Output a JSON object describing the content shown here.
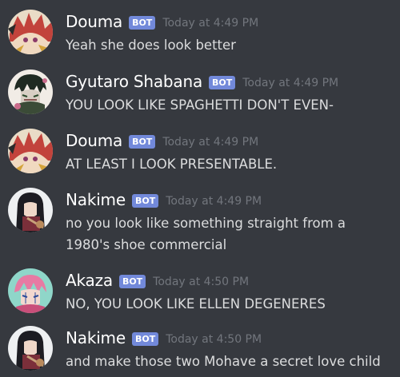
{
  "messages": [
    {
      "author": "Douma",
      "badge": "BOT",
      "time": "Today at 4:49 PM",
      "text": "Yeah she does look better",
      "avatar": "douma-avatar"
    },
    {
      "author": "Gyutaro Shabana",
      "badge": "BOT",
      "time": "Today at 4:49 PM",
      "text": "YOU LOOK LIKE SPAGHETTI DON'T EVEN-",
      "avatar": "gyutaro-avatar"
    },
    {
      "author": "Douma",
      "badge": "BOT",
      "time": "Today at 4:49 PM",
      "text": "AT LEAST I LOOK PRESENTABLE.",
      "avatar": "douma-avatar"
    },
    {
      "author": "Nakime",
      "badge": "BOT",
      "time": "Today at 4:49 PM",
      "text": "no you look like something straight from a 1980's shoe commercial",
      "avatar": "nakime-avatar"
    },
    {
      "author": "Akaza",
      "badge": "BOT",
      "time": "Today at 4:50 PM",
      "text": "NO, YOU LOOK LIKE ELLEN DEGENERES",
      "avatar": "akaza-avatar"
    },
    {
      "author": "Nakime",
      "badge": "BOT",
      "time": "Today at 4:50 PM",
      "text": "and make those two Mohave a secret love child",
      "avatar": "nakime-avatar"
    }
  ],
  "colors": {
    "background": "#36393f",
    "author": "#ffffff",
    "bot_badge": "#7289da",
    "timestamp": "#72767d",
    "text": "#dcddde"
  }
}
